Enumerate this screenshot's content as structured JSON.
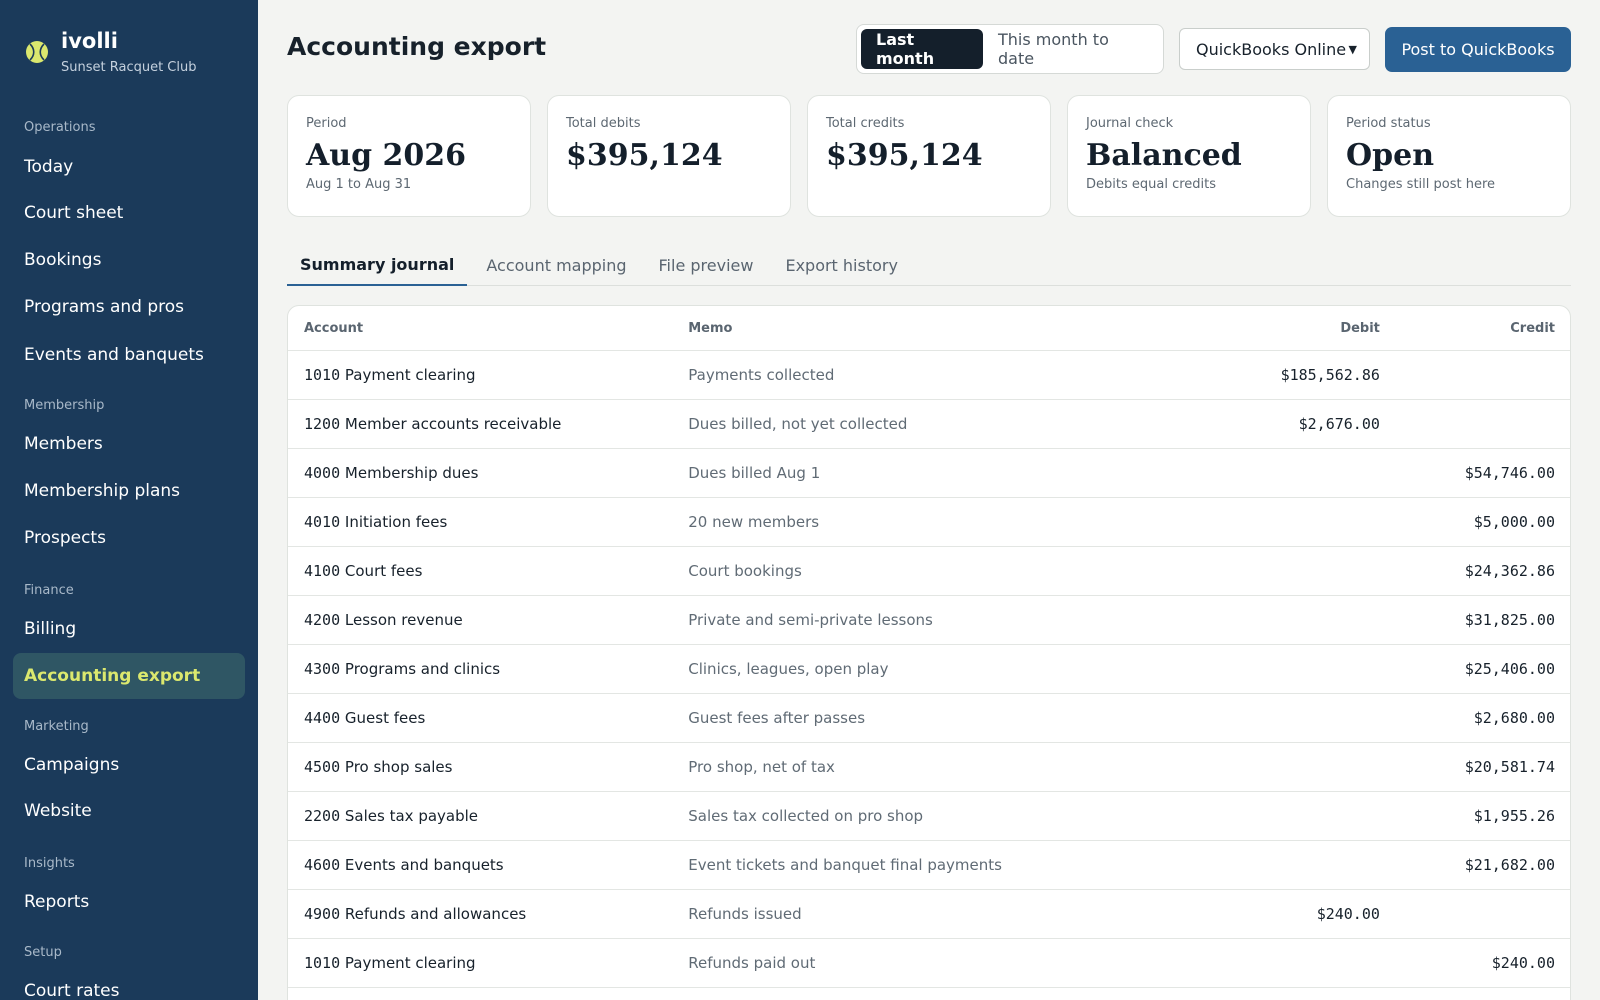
{
  "brand": {
    "name": "ivolli",
    "subtitle": "Sunset Racquet Club",
    "logo_icon": "tennis-ball-icon"
  },
  "nav": {
    "groups": [
      {
        "label": "Operations",
        "items": [
          "Today",
          "Court sheet",
          "Bookings",
          "Programs and pros",
          "Events and banquets"
        ]
      },
      {
        "label": "Membership",
        "items": [
          "Members",
          "Membership plans",
          "Prospects"
        ]
      },
      {
        "label": "Finance",
        "items": [
          "Billing",
          "Accounting export"
        ]
      },
      {
        "label": "Marketing",
        "items": [
          "Campaigns",
          "Website"
        ]
      },
      {
        "label": "Insights",
        "items": [
          "Reports"
        ]
      },
      {
        "label": "Setup",
        "items": [
          "Court rates"
        ]
      }
    ],
    "active": "Accounting export"
  },
  "header": {
    "title": "Accounting export",
    "range_options": [
      "Last month",
      "This month to date"
    ],
    "range_selected": "Last month",
    "destination": "QuickBooks Online",
    "post_label": "Post to QuickBooks"
  },
  "cards": [
    {
      "label": "Period",
      "value": "Aug 2026",
      "sub": "Aug 1 to Aug 31"
    },
    {
      "label": "Total debits",
      "value": "$395,124",
      "sub": ""
    },
    {
      "label": "Total credits",
      "value": "$395,124",
      "sub": ""
    },
    {
      "label": "Journal check",
      "value": "Balanced",
      "sub": "Debits equal credits"
    },
    {
      "label": "Period status",
      "value": "Open",
      "sub": "Changes still post here"
    }
  ],
  "tabs": [
    "Summary journal",
    "Account mapping",
    "File preview",
    "Export history"
  ],
  "active_tab": "Summary journal",
  "table": {
    "columns": {
      "account": "Account",
      "memo": "Memo",
      "debit": "Debit",
      "credit": "Credit"
    },
    "rows": [
      {
        "code": "1010",
        "account": "Payment clearing",
        "memo": "Payments collected",
        "debit": "$185,562.86",
        "credit": ""
      },
      {
        "code": "1200",
        "account": "Member accounts receivable",
        "memo": "Dues billed, not yet collected",
        "debit": "$2,676.00",
        "credit": ""
      },
      {
        "code": "4000",
        "account": "Membership dues",
        "memo": "Dues billed Aug 1",
        "debit": "",
        "credit": "$54,746.00"
      },
      {
        "code": "4010",
        "account": "Initiation fees",
        "memo": "20 new members",
        "debit": "",
        "credit": "$5,000.00"
      },
      {
        "code": "4100",
        "account": "Court fees",
        "memo": "Court bookings",
        "debit": "",
        "credit": "$24,362.86"
      },
      {
        "code": "4200",
        "account": "Lesson revenue",
        "memo": "Private and semi-private lessons",
        "debit": "",
        "credit": "$31,825.00"
      },
      {
        "code": "4300",
        "account": "Programs and clinics",
        "memo": "Clinics, leagues, open play",
        "debit": "",
        "credit": "$25,406.00"
      },
      {
        "code": "4400",
        "account": "Guest fees",
        "memo": "Guest fees after passes",
        "debit": "",
        "credit": "$2,680.00"
      },
      {
        "code": "4500",
        "account": "Pro shop sales",
        "memo": "Pro shop, net of tax",
        "debit": "",
        "credit": "$20,581.74"
      },
      {
        "code": "2200",
        "account": "Sales tax payable",
        "memo": "Sales tax collected on pro shop",
        "debit": "",
        "credit": "$1,955.26"
      },
      {
        "code": "4600",
        "account": "Events and banquets",
        "memo": "Event tickets and banquet final payments",
        "debit": "",
        "credit": "$21,682.00"
      },
      {
        "code": "4900",
        "account": "Refunds and allowances",
        "memo": "Refunds issued",
        "debit": "$240.00",
        "credit": ""
      },
      {
        "code": "1010",
        "account": "Payment clearing",
        "memo": "Refunds paid out",
        "debit": "",
        "credit": "$240.00"
      }
    ]
  },
  "colors": {
    "sidebar": "#1b3a5a",
    "active_nav_bg": "#2f5664",
    "active_nav_text": "#dbe86e",
    "primary": "#2a6194"
  }
}
